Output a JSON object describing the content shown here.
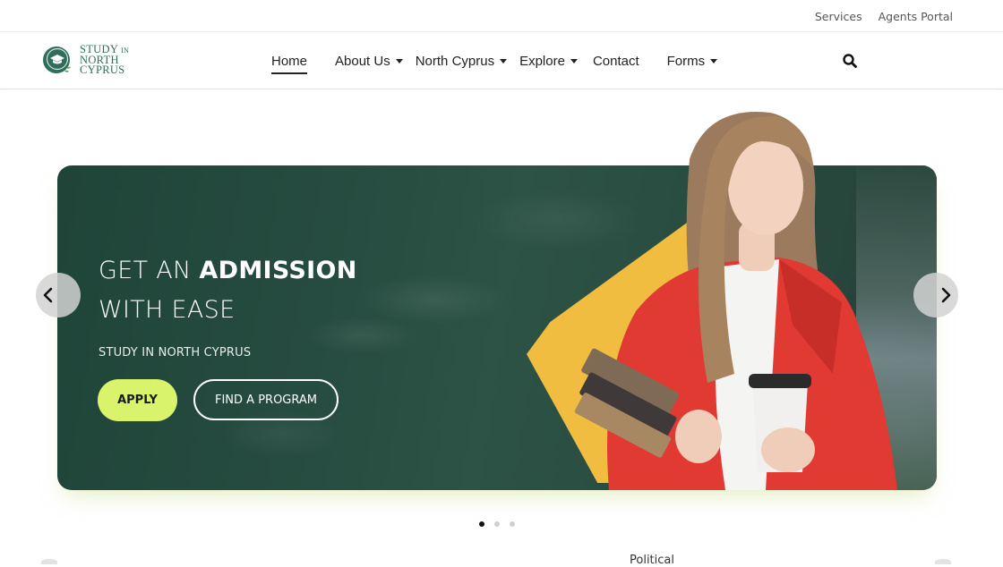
{
  "topbar": {
    "links": [
      {
        "label": "Services"
      },
      {
        "label": "Agents Portal"
      }
    ]
  },
  "header": {
    "logo": {
      "line1": "STUDY",
      "line1_small": "IN",
      "line2": "NORTH",
      "line3": "CYPRUS",
      "color": "#2f6e5b"
    },
    "nav": [
      {
        "label": "Home",
        "active": true,
        "dropdown": false
      },
      {
        "label": "About Us",
        "dropdown": true
      },
      {
        "label": "North Cyprus",
        "dropdown": true
      },
      {
        "label": "Explore",
        "dropdown": true
      },
      {
        "label": "Contact",
        "dropdown": false
      },
      {
        "label": "Forms",
        "dropdown": true
      }
    ],
    "search_icon": "search-icon"
  },
  "hero": {
    "title_prefix": "GET AN ",
    "title_bold": "ADMISSION",
    "title_line2": "WITH EASE",
    "subtitle": "STUDY IN NORTH CYPRUS",
    "apply_label": "APPLY",
    "find_label": "FIND A PROGRAM",
    "accent_color": "#d9f46c",
    "shape_color": "#f0bd40",
    "background_color": "#264b40",
    "prev_icon": "chevron-left-icon",
    "next_icon": "chevron-right-icon"
  },
  "carousel": {
    "slides": 3,
    "active_index": 0
  },
  "below": {
    "partial_label": "Political"
  }
}
